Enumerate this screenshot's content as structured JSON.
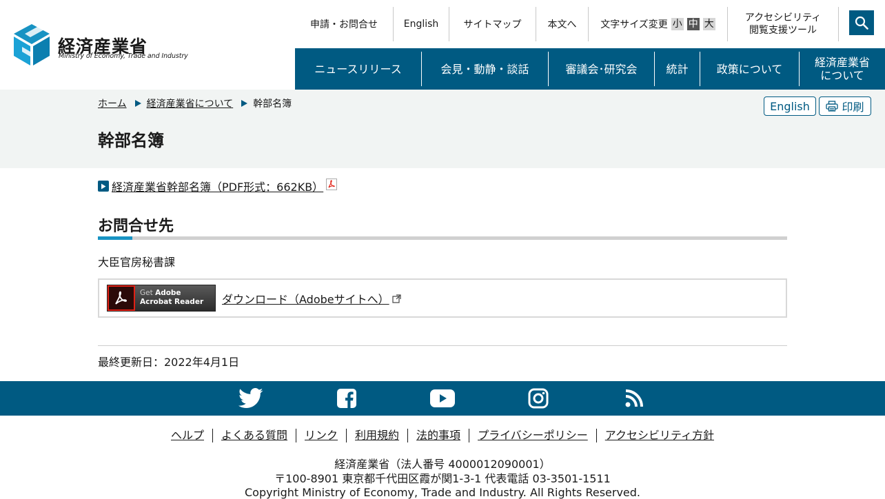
{
  "header": {
    "logo_name": "経済産業省",
    "logo_en": "Ministry of Economy, Trade and Industry",
    "util": {
      "contact": "申請・お問合せ",
      "english": "English",
      "sitemap": "サイトマップ",
      "to_body": "本文へ",
      "font_size_label": "文字サイズ変更",
      "font_small": "小",
      "font_medium": "中",
      "font_large": "大",
      "accessibility_line1": "アクセシビリティ",
      "accessibility_line2": "閲覧支援ツール"
    },
    "nav": {
      "news": "ニュースリリース",
      "press": "会見・動静・談話",
      "council": "審議会･研究会",
      "stats": "統計",
      "policy": "政策について",
      "about_line1": "経済産業省",
      "about_line2": "について"
    }
  },
  "breadcrumb": {
    "home": "ホーム",
    "about": "経済産業省について",
    "current": "幹部名簿"
  },
  "tools": {
    "english": "English",
    "print": "印刷"
  },
  "page_title": "幹部名簿",
  "content": {
    "pdf_link": "経済産業省幹部名簿（PDF形式：662KB）",
    "section_heading": "お問合せ先",
    "contact_dept": "大臣官房秘書課",
    "acrobat_line1_pre": "Get",
    "acrobat_line1_bold": "Adobe",
    "acrobat_line2": "Acrobat Reader",
    "download_link": "ダウンロード（Adobeサイトへ）",
    "last_updated": "最終更新日：2022年4月1日"
  },
  "footer": {
    "links": [
      "ヘルプ",
      "よくある質問",
      "リンク",
      "利用規約",
      "法的事項",
      "プライバシーポリシー",
      "アクセシビリティ方針"
    ],
    "org": "経済産業省（法人番号 4000012090001）",
    "address": "〒100-8901 東京都千代田区霞が関1-3-1 代表電話 03-3501-1511",
    "copyright": "Copyright Ministry of Economy, Trade and Industry. All Rights Reserved."
  },
  "colors": {
    "brand": "#005a82",
    "accent": "#1893c3",
    "band": "#f1f4f3"
  },
  "icons": [
    "meti-logo-icon",
    "search-icon",
    "printer-icon",
    "pdf-icon",
    "external-link-icon",
    "twitter-icon",
    "facebook-icon",
    "youtube-icon",
    "instagram-icon",
    "rss-icon"
  ]
}
